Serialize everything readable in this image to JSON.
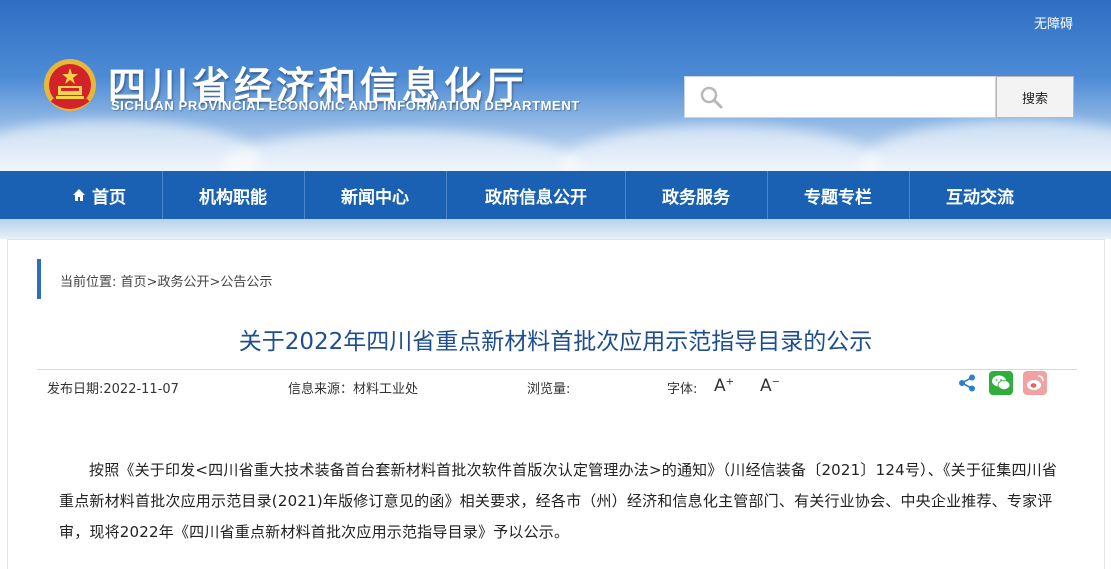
{
  "header": {
    "accessibility_label": "无障碍",
    "title": "四川省经济和信息化厅",
    "subtitle": "SICHUAN PROVINCIAL ECONOMIC AND INFORMATION DEPARTMENT",
    "search": {
      "placeholder": "",
      "button_label": "搜索"
    }
  },
  "nav": {
    "items": [
      {
        "label": "首页",
        "icon": "home-icon"
      },
      {
        "label": "机构职能"
      },
      {
        "label": "新闻中心"
      },
      {
        "label": "政府信息公开"
      },
      {
        "label": "政务服务"
      },
      {
        "label": "专题专栏"
      },
      {
        "label": "互动交流"
      }
    ]
  },
  "breadcrumb": {
    "prefix": "当前位置: ",
    "items": [
      "首页",
      "政务公开",
      "公告公示"
    ],
    "separator": ">"
  },
  "article": {
    "title": "关于2022年四川省重点新材料首批次应用示范指导目录的公示",
    "meta": {
      "date_label": "发布日期:",
      "date": "2022-11-07",
      "source_label": "信息来源：",
      "source": "材料工业处",
      "views_label": "浏览量:",
      "font_label": "字体:",
      "font_increase": "A",
      "font_decrease": "A"
    },
    "body": "按照《关于印发<四川省重大技术装备首台套新材料首批次软件首版次认定管理办法>的通知》（川经信装备〔2021〕124号）、《关于征集四川省重点新材料首批次应用示范目录(2021)年版修订意见的函》相关要求，经各市（州）经济和信息化主管部门、有关行业协会、中央企业推荐、专家评审，现将2022年《四川省重点新材料首批次应用示范指导目录》予以公示。"
  },
  "share": {
    "icons": [
      "share-icon",
      "wechat-icon",
      "weibo-icon"
    ]
  },
  "colors": {
    "nav_bg": "#1a61b3",
    "title": "#1e4e90",
    "accent": "#2c6fc0"
  }
}
